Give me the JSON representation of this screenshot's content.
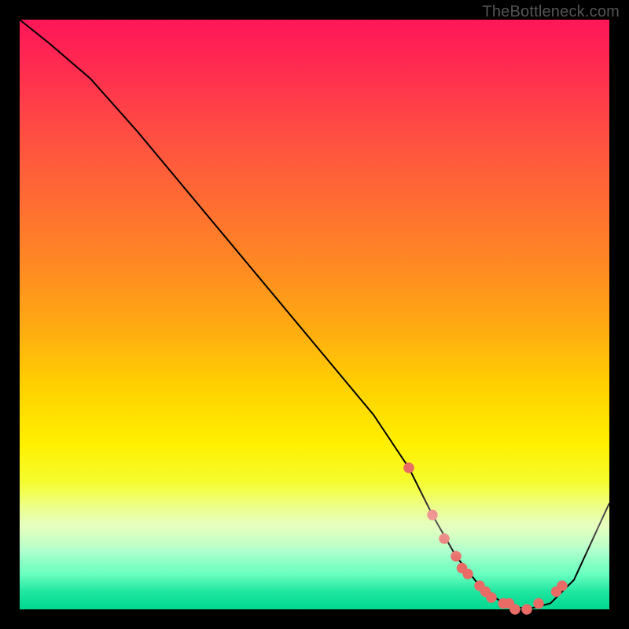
{
  "watermark": "TheBottleneck.com",
  "colors": {
    "curve_stroke": "#000000",
    "marker_fill": "#e86b66",
    "marker_stroke": "#e86b66",
    "background": "#000000"
  },
  "chart_data": {
    "type": "line",
    "title": "",
    "xlabel": "",
    "ylabel": "",
    "xlim": [
      0,
      100
    ],
    "ylim": [
      0,
      100
    ],
    "grid": false,
    "legend": false,
    "series": [
      {
        "name": "bottleneck-curve",
        "x": [
          0,
          5,
          12,
          20,
          30,
          40,
          50,
          60,
          66,
          70,
          74,
          78,
          82,
          86,
          90,
          94,
          100
        ],
        "values": [
          100,
          96,
          90,
          81,
          69,
          57,
          45,
          33,
          24,
          16,
          9,
          4,
          1,
          0,
          1,
          5,
          18
        ]
      }
    ],
    "markers": {
      "name": "highlight-dots",
      "x": [
        66,
        70,
        72,
        74,
        75,
        76,
        78,
        79,
        80,
        82,
        83,
        84,
        86,
        88,
        91,
        92
      ],
      "values": [
        24,
        16,
        12,
        9,
        7,
        6,
        4,
        3,
        2,
        1,
        1,
        0,
        0,
        1,
        3,
        4
      ]
    }
  }
}
